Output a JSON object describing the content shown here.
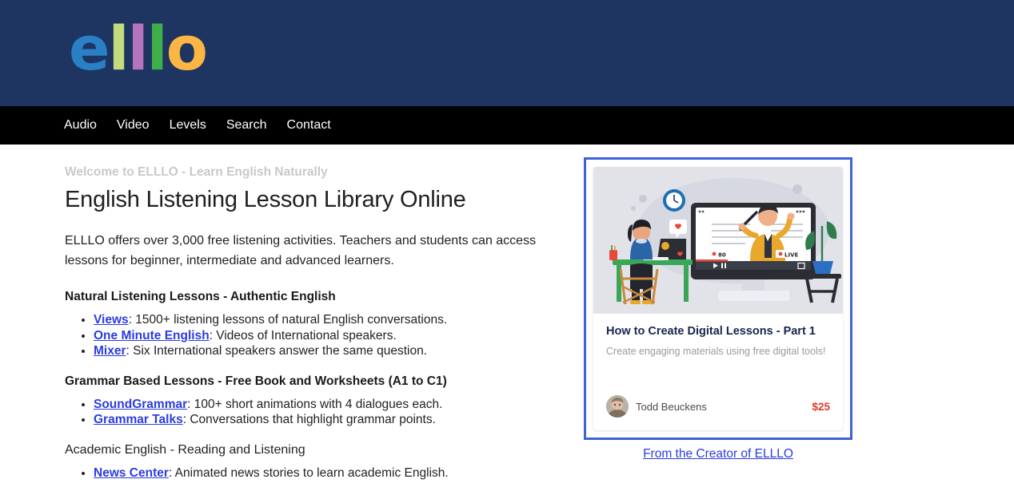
{
  "header": {
    "logo_letters": [
      {
        "char": "e",
        "color": "#2980c4"
      },
      {
        "char": "l",
        "color": "#c5dc7e"
      },
      {
        "char": "l",
        "color": "#b574bd"
      },
      {
        "char": "l",
        "color": "#3eae49"
      },
      {
        "char": "o",
        "color": "#fcb643"
      }
    ],
    "background": "#1e3461"
  },
  "nav": {
    "background": "#000000",
    "items": [
      {
        "label": "Audio"
      },
      {
        "label": "Video"
      },
      {
        "label": "Levels"
      },
      {
        "label": "Search"
      },
      {
        "label": "Contact"
      }
    ]
  },
  "main": {
    "welcome": "Welcome to ELLLO - Learn English Naturally",
    "title": "English Listening Lesson Library Online",
    "intro": "ELLLO offers over 3,000 free listening activities. Teachers and students can access lessons for beginner, intermediate and advanced learners.",
    "sections": [
      {
        "heading": "Natural Listening Lessons - Authentic English",
        "heading_bold": true,
        "items": [
          {
            "link": "Views",
            "desc": ": 1500+ listening lessons of natural English conversations."
          },
          {
            "link": "One Minute English",
            "desc": ": Videos of International speakers."
          },
          {
            "link": "Mixer",
            "desc": ": Six International speakers answer the same question."
          }
        ]
      },
      {
        "heading": "Grammar Based Lessons - Free Book and Worksheets (A1 to C1)",
        "heading_bold": true,
        "items": [
          {
            "link": "SoundGrammar",
            "desc": ": 100+ short animations with 4 dialogues each."
          },
          {
            "link": "Grammar Talks",
            "desc": ": Conversations that highlight grammar points."
          }
        ]
      },
      {
        "heading": "Academic English - Reading and Listening",
        "heading_bold": false,
        "items": [
          {
            "link": "News Center",
            "desc": ": Animated news stories to learn academic English."
          }
        ]
      }
    ],
    "link_color": "#2b3ce0"
  },
  "promo": {
    "border_color": "#3d63d6",
    "title": "How to Create Digital Lessons - Part 1",
    "subtitle": "Create engaging materials using free digital tools!",
    "author": "Todd Beuckens",
    "price": "$25",
    "price_color": "#e03a26",
    "illustration_name": "online-teaching-illustration",
    "illustration_labels": {
      "viewers": "80",
      "live": "LIVE"
    },
    "creator_link": "From the Creator of ELLLO"
  }
}
